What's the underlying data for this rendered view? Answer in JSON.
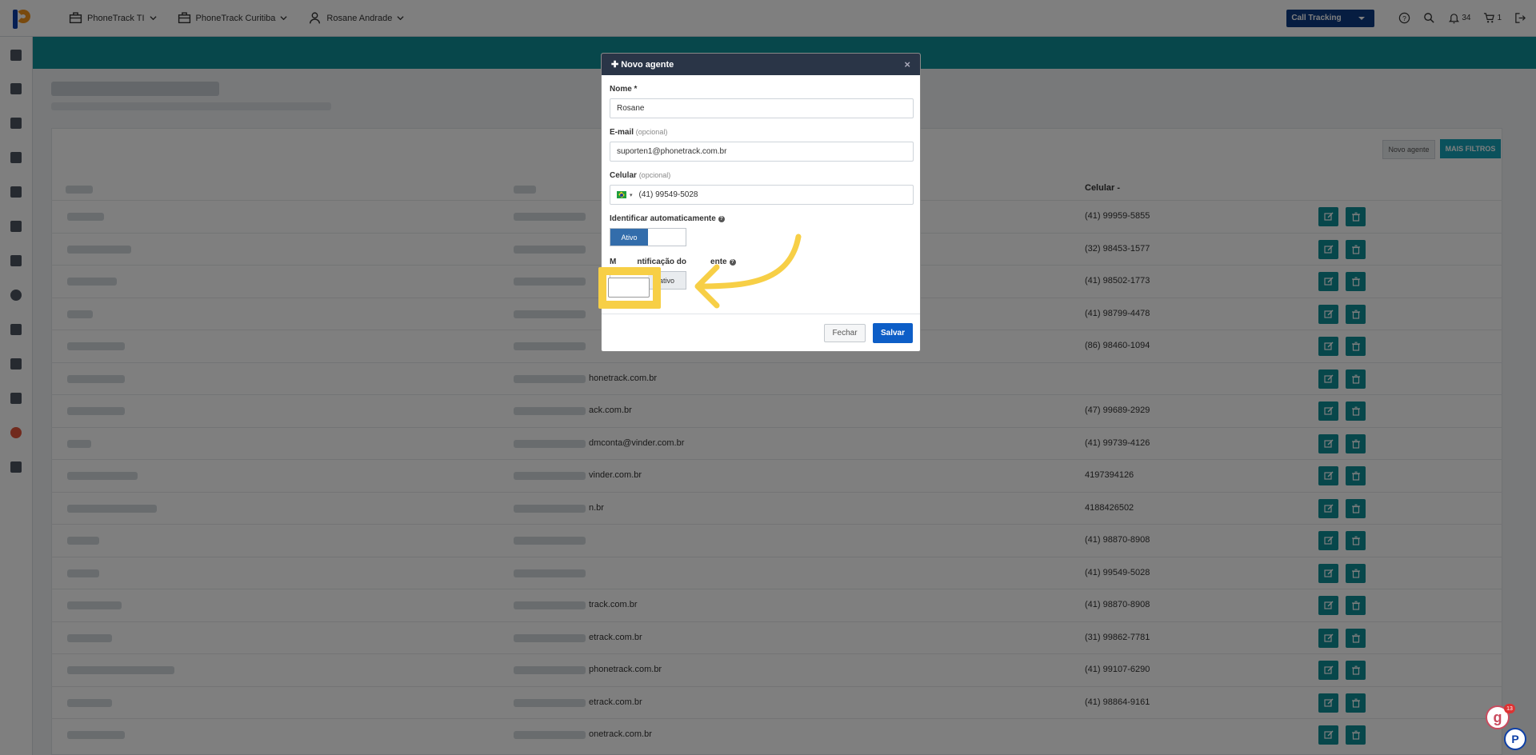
{
  "topbar": {
    "nav": [
      {
        "label": "PhoneTrack TI",
        "icon": "briefcase-icon"
      },
      {
        "label": "PhoneTrack Curitiba",
        "icon": "briefcase-icon"
      },
      {
        "label": "Rosane Andrade",
        "icon": "user-icon"
      }
    ],
    "product_select": "Call Tracking",
    "notifications_count": "34",
    "cart_count": "1",
    "accent_color": "#0d3b82"
  },
  "page": {
    "btn_novo": "Novo agente",
    "btn_mais": "MAIS FILTROS",
    "col_celular": "Celular"
  },
  "rows": [
    {
      "email": "",
      "cel": "(41) 99959-5855"
    },
    {
      "email": "",
      "cel": "(32) 98453-1577"
    },
    {
      "email": "",
      "cel": "(41) 98502-1773"
    },
    {
      "email": "",
      "cel": "(41) 98799-4478"
    },
    {
      "email": "",
      "cel": "(86) 98460-1094"
    },
    {
      "email": "honetrack.com.br",
      "cel": ""
    },
    {
      "email": "ack.com.br",
      "cel": "(47) 99689-2929"
    },
    {
      "email": "dmconta@vinder.com.br",
      "cel": "(41) 99739-4126"
    },
    {
      "email": "vinder.com.br",
      "cel": "4197394126"
    },
    {
      "email": "n.br",
      "cel": "4188426502"
    },
    {
      "email": "",
      "cel": "(41) 98870-8908"
    },
    {
      "email": "",
      "cel": "(41) 99549-5028"
    },
    {
      "email": "track.com.br",
      "cel": "(41) 98870-8908"
    },
    {
      "email": "etrack.com.br",
      "cel": "(31) 99862-7781"
    },
    {
      "email": "phonetrack.com.br",
      "cel": "(41) 99107-6290"
    },
    {
      "email": "etrack.com.br",
      "cel": "(41) 98864-9161"
    },
    {
      "email": "onetrack.com.br",
      "cel": ""
    }
  ],
  "modal": {
    "title": "Novo agente",
    "close": "×",
    "nome_label": "Nome *",
    "nome_value": "Rosane",
    "email_label": "E-mail",
    "email_opt": "(opcional)",
    "email_value": "suporten1@phonetrack.com.br",
    "cel_label": "Celular",
    "cel_opt": "(opcional)",
    "cel_value": "(41) 99549-5028",
    "auto_label": "Identificar automaticamente",
    "auto_toggle_on": "Ativo",
    "ident_label_a": "M",
    "ident_label_b": "ntificação do",
    "ident_label_c": "ente",
    "ident_toggle": "ativo",
    "fechar": "Fechar",
    "salvar": "Salvar"
  },
  "widgets": {
    "g_badge": "g",
    "g_count": "13",
    "p_badge": "P"
  }
}
